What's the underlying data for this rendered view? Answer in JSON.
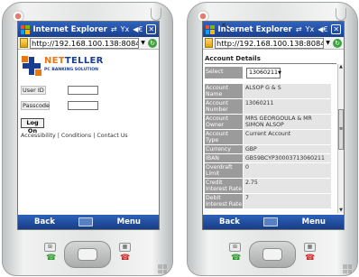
{
  "browser": {
    "app_title": "Internet Explorer",
    "url_left": "http://192.168.100.138:8084/n",
    "url_right": "http://192.168.100.138:8084/n"
  },
  "softkeys": {
    "left": "Back",
    "right": "Menu"
  },
  "login": {
    "brand_name": "NETELLER",
    "brand_net": "NET",
    "brand_teller": "TELLER",
    "tagline": "PC BANKING SOLUTION",
    "userid_label": "User ID",
    "passcode_label": "Passcode",
    "login_button": "Log On",
    "links": "Accessibility | Conditions | Contact Us"
  },
  "details": {
    "title": "Account Details",
    "select_label": "Select Account",
    "select_value": "13060211",
    "rows": [
      {
        "k": "Account Name",
        "v": "ALSOP G & S"
      },
      {
        "k": "Account Number",
        "v": "13060211"
      },
      {
        "k": "Account Owner",
        "v": "MRS GEORGOULA & MR SIMON ALSOP"
      },
      {
        "k": "Account Type",
        "v": "Current Account"
      },
      {
        "k": "Currency",
        "v": "GBP"
      },
      {
        "k": "IBAN",
        "v": "GB59BCYP30003713060211"
      },
      {
        "k": "Overdraft Limit",
        "v": "0"
      },
      {
        "k": "Credit Interest Rate",
        "v": "2.75"
      },
      {
        "k": "Debit Interest Rate",
        "v": "7"
      }
    ]
  },
  "colors": {
    "titlebar": "#1b3f8e",
    "accent_orange": "#e9770e",
    "brand_blue": "#1a3d91"
  }
}
